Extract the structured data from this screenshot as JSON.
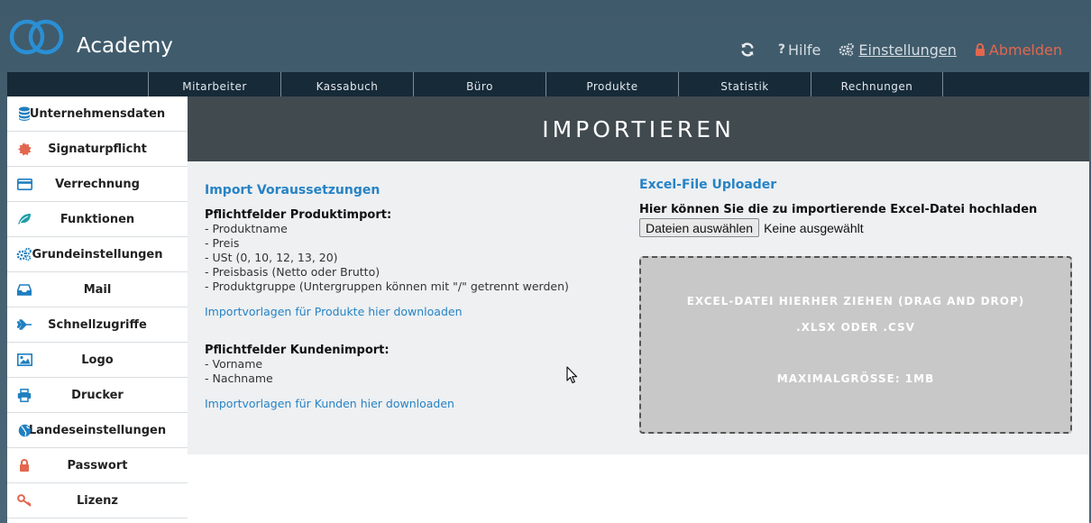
{
  "header": {
    "app_title": "Academy",
    "actions": {
      "help": "Hilfe",
      "settings": "Einstellungen",
      "logout": "Abmelden"
    }
  },
  "nav": {
    "tabs": [
      "Mitarbeiter",
      "Kassabuch",
      "Büro",
      "Produkte",
      "Statistik",
      "Rechnungen"
    ]
  },
  "sidebar": {
    "items": [
      {
        "label": "Unternehmensdaten",
        "icon": "database-icon",
        "color": "#1f7fc0"
      },
      {
        "label": "Signaturpflicht",
        "icon": "seal-icon",
        "color": "#e2674e"
      },
      {
        "label": "Verrechnung",
        "icon": "credit-card-icon",
        "color": "#1f7fc0"
      },
      {
        "label": "Funktionen",
        "icon": "leaf-icon",
        "color": "#1f9fa8"
      },
      {
        "label": "Grundeinstellungen",
        "icon": "gears-icon",
        "color": "#1f7fc0"
      },
      {
        "label": "Mail",
        "icon": "inbox-icon",
        "color": "#1f7fc0"
      },
      {
        "label": "Schnellzugriffe",
        "icon": "plane-icon",
        "color": "#1f7fc0"
      },
      {
        "label": "Logo",
        "icon": "image-icon",
        "color": "#1f7fc0"
      },
      {
        "label": "Drucker",
        "icon": "printer-icon",
        "color": "#1f7fc0"
      },
      {
        "label": "Landeseinstellungen",
        "icon": "globe-icon",
        "color": "#1f7fc0"
      },
      {
        "label": "Passwort",
        "icon": "lock-icon",
        "color": "#e2674e"
      },
      {
        "label": "Lizenz",
        "icon": "key-icon",
        "color": "#e2674e"
      }
    ]
  },
  "main": {
    "banner_title": "IMPORTIEREN",
    "requirements": {
      "heading": "Import Voraussetzungen",
      "product": {
        "title": "Pflichtfelder Produktimport:",
        "fields": [
          "- Produktname",
          "- Preis",
          "- USt (0, 10, 12, 13, 20)",
          "- Preisbasis (Netto oder Brutto)",
          "- Produktgruppe (Untergruppen können mit \"/\" getrennt werden)"
        ],
        "link": "Importvorlagen für Produkte hier downloaden"
      },
      "customer": {
        "title": "Pflichtfelder Kundenimport:",
        "fields": [
          "- Vorname",
          "- Nachname"
        ],
        "link": "Importvorlagen für Kunden hier downloaden"
      }
    },
    "uploader": {
      "heading": "Excel-File Uploader",
      "hint": "Hier können Sie die zu importierende Excel-Datei hochladen",
      "choose_button": "Dateien auswählen",
      "no_file": "Keine ausgewählt",
      "drop_line1": "EXCEL-DATEI HIERHER ZIEHEN (DRAG AND DROP)",
      "drop_line2": ".XLSX ODER .CSV",
      "drop_line3": "MAXIMALGRÖSSE: 1MB"
    }
  },
  "colors": {
    "accent_blue": "#2683c5",
    "logout_red": "#e2674e",
    "nav_bg": "#162a38",
    "banner_bg": "#404a4f"
  }
}
